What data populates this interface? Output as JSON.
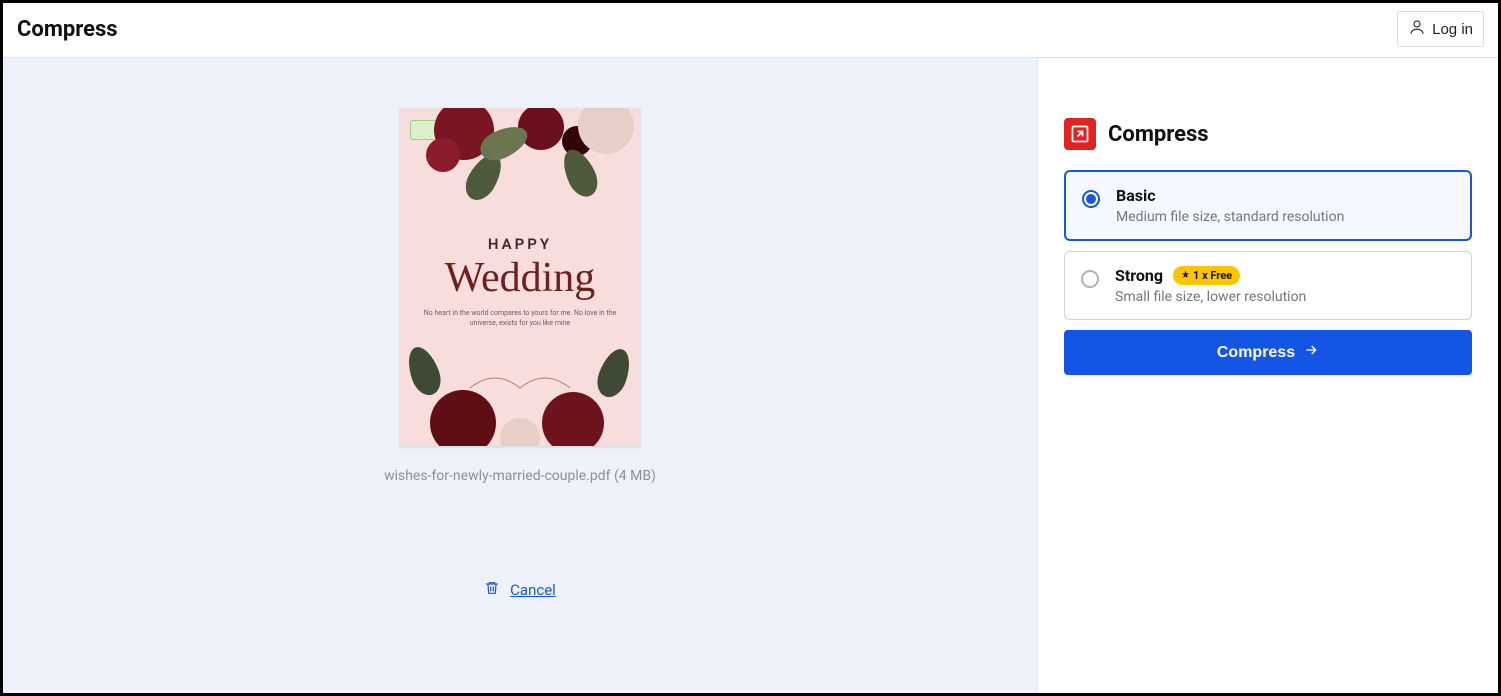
{
  "header": {
    "title": "Compress",
    "login_label": "Log in"
  },
  "preview": {
    "card": {
      "line1": "HAPPY",
      "line2": "Wedding",
      "subtext": "No heart in the world compares to yours for me. No love in the universe, exists for you like mine"
    },
    "filename": "wishes-for-newly-married-couple.pdf (4 MB)",
    "cancel_label": "Cancel"
  },
  "side": {
    "title": "Compress",
    "options": [
      {
        "name": "Basic",
        "desc": "Medium file size, standard resolution",
        "selected": true,
        "badge": null
      },
      {
        "name": "Strong",
        "desc": "Small file size, lower resolution",
        "selected": false,
        "badge": "1 x Free"
      }
    ],
    "cta_label": "Compress"
  }
}
